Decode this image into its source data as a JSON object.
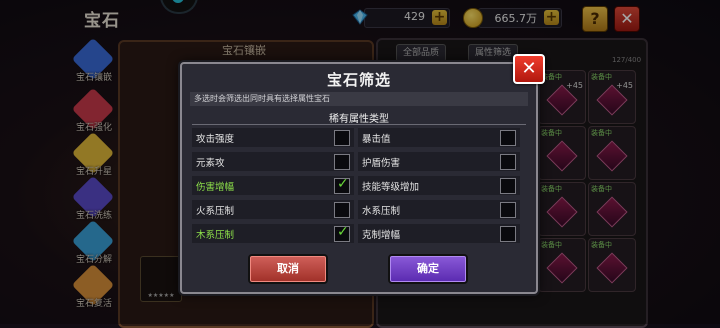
{
  "header": {
    "title": "宝石",
    "diamonds": "429",
    "gold": "665.7万",
    "help_label": "?",
    "close_label": "✕"
  },
  "sidebar": {
    "items": [
      {
        "label": "宝石镶嵌",
        "color": "#3a6ad8"
      },
      {
        "label": "宝石强化",
        "color": "#c83a4a"
      },
      {
        "label": "宝石升星",
        "color": "#e0b83a"
      },
      {
        "label": "宝石洗练",
        "color": "#5a4ac8"
      },
      {
        "label": "宝石分解",
        "color": "#3aa0d8"
      },
      {
        "label": "宝石复活",
        "color": "#d8903a"
      }
    ]
  },
  "left_panel": {
    "title": "宝石镶嵌"
  },
  "right_panel": {
    "tab_all": "全部品质",
    "tab_filter": "属性筛选",
    "count": "127/400",
    "cell_tag": "装备中",
    "cell_level": "+45"
  },
  "modal": {
    "title": "宝石筛选",
    "close_label": "✕",
    "note": "多选时会筛选出同时具有选择属性宝石",
    "section": "稀有属性类型",
    "options_left": [
      {
        "name": "攻击强度",
        "checked": false
      },
      {
        "name": "元素攻",
        "checked": false
      },
      {
        "name": "伤害增幅",
        "checked": true
      },
      {
        "name": "火系压制",
        "checked": false
      },
      {
        "name": "木系压制",
        "checked": true
      }
    ],
    "options_right": [
      {
        "name": "暴击值",
        "checked": false
      },
      {
        "name": "护盾伤害",
        "checked": false
      },
      {
        "name": "技能等级增加",
        "checked": false
      },
      {
        "name": "水系压制",
        "checked": false
      },
      {
        "name": "克制增幅",
        "checked": false
      }
    ],
    "cancel_label": "取消",
    "confirm_label": "确定"
  },
  "colors": {
    "check": "#6ad83a",
    "checked_text": "#8ee24a",
    "cancel": "#a03028",
    "confirm": "#5a2ab0",
    "close": "#d0281c"
  }
}
